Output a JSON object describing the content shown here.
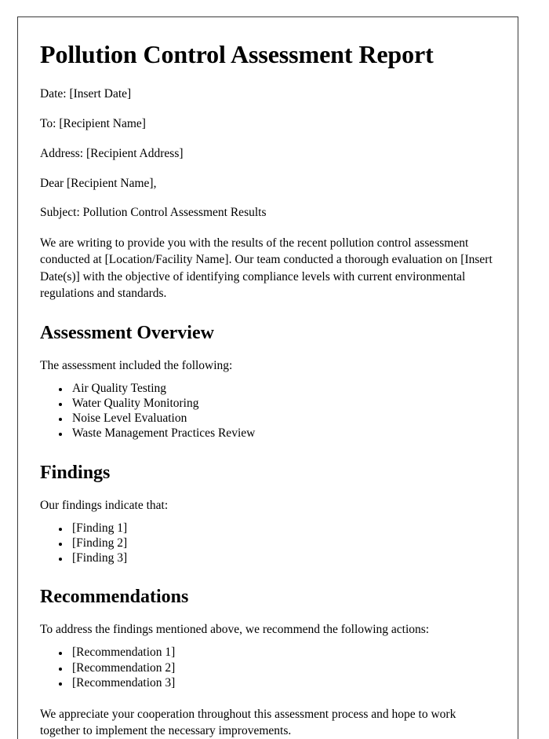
{
  "document": {
    "title": "Pollution Control Assessment Report",
    "header_lines": [
      "Date: [Insert Date]",
      "To: [Recipient Name]",
      "Address: [Recipient Address]",
      "Dear [Recipient Name],",
      "Subject: Pollution Control Assessment Results"
    ],
    "opening_paragraph": "We are writing to provide you with the results of the recent pollution control assessment conducted at [Location/Facility Name]. Our team conducted a thorough evaluation on [Insert Date(s)] with the objective of identifying compliance levels with current environmental regulations and standards.",
    "sections": [
      {
        "heading": "Assessment Overview",
        "intro": "The assessment included the following:",
        "items": [
          "Air Quality Testing",
          "Water Quality Monitoring",
          "Noise Level Evaluation",
          "Waste Management Practices Review"
        ]
      },
      {
        "heading": "Findings",
        "intro": "Our findings indicate that:",
        "items": [
          "[Finding 1]",
          "[Finding 2]",
          "[Finding 3]"
        ]
      },
      {
        "heading": "Recommendations",
        "intro": "To address the findings mentioned above, we recommend the following actions:",
        "items": [
          "[Recommendation 1]",
          "[Recommendation 2]",
          "[Recommendation 3]"
        ]
      }
    ],
    "closing_paragraph": "We appreciate your cooperation throughout this assessment process and hope to work together to implement the necessary improvements."
  },
  "style": {
    "page_background": "#ffffff",
    "page_border_color": "#3a3a3a",
    "text_color": "#000000"
  }
}
